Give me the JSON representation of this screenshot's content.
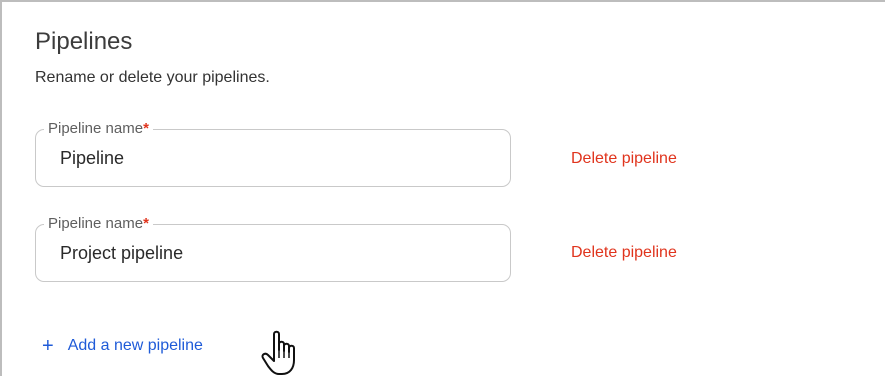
{
  "section": {
    "title": "Pipelines",
    "subtitle": "Rename or delete your pipelines."
  },
  "pipelines": [
    {
      "label": "Pipeline name",
      "required_mark": "*",
      "value": "Pipeline",
      "delete_label": "Delete pipeline"
    },
    {
      "label": "Pipeline name",
      "required_mark": "*",
      "value": "Project pipeline",
      "delete_label": "Delete pipeline"
    }
  ],
  "actions": {
    "add_icon": "+",
    "add_label": "Add a new pipeline"
  },
  "icons": {
    "add": "plus-icon",
    "cursor": "hand-pointer-icon"
  },
  "colors": {
    "danger": "#e0341d",
    "link": "#1f5bd8",
    "border": "#c9c9c9"
  }
}
